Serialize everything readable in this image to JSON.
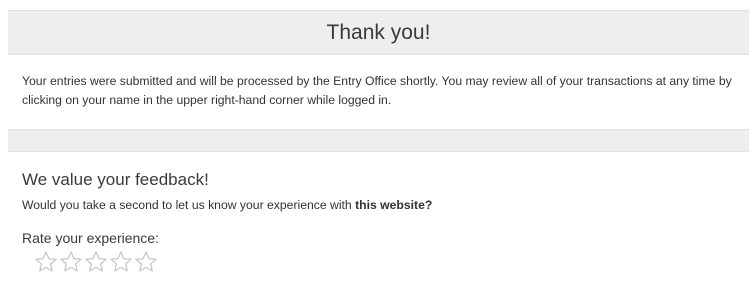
{
  "header": {
    "title": "Thank you!"
  },
  "confirmation": {
    "message": "Your entries were submitted and will be processed by the Entry Office shortly. You may review all of your transactions at any time by clicking on your name in the upper right-hand corner while logged in."
  },
  "feedback": {
    "title": "We value your feedback!",
    "question_prefix": "Would you take a second to let us know your experience with ",
    "question_emphasis": "this website?",
    "rate_label": "Rate your experience:",
    "stars": [
      {
        "icon": "star-outline-icon",
        "value": 1
      },
      {
        "icon": "star-outline-icon",
        "value": 2
      },
      {
        "icon": "star-outline-icon",
        "value": 3
      },
      {
        "icon": "star-outline-icon",
        "value": 4
      },
      {
        "icon": "star-outline-icon",
        "value": 5
      }
    ],
    "selected_rating": 0
  },
  "colors": {
    "panel_bg": "#eeeeee",
    "star_stroke": "#c8c8c8"
  }
}
